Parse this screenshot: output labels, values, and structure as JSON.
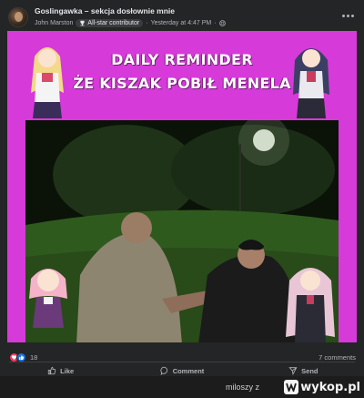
{
  "post": {
    "group_name": "Goslingawka – sekcja dosłownie mnie",
    "author": "John Marston",
    "badge_label": "All-star contributor",
    "timestamp": "Yesterday at 4:47 PM",
    "separator": "·"
  },
  "meme": {
    "line1": "DAILY REMINDER",
    "line2": "ŻE KISZAK POBIŁ MENELA",
    "background_color": "#d63ad9"
  },
  "reactions": {
    "count": "18",
    "icons": [
      "heart-icon",
      "like-icon"
    ],
    "comments": "7 comments"
  },
  "actions": {
    "like": "Like",
    "comment": "Comment",
    "send": "Send"
  },
  "watermark": {
    "user": "miloszy z",
    "site": "wykop.pl"
  },
  "colors": {
    "card": "#242526",
    "text_secondary": "#b0b3b8",
    "heart": "#f33e58",
    "like": "#1b74e4"
  }
}
